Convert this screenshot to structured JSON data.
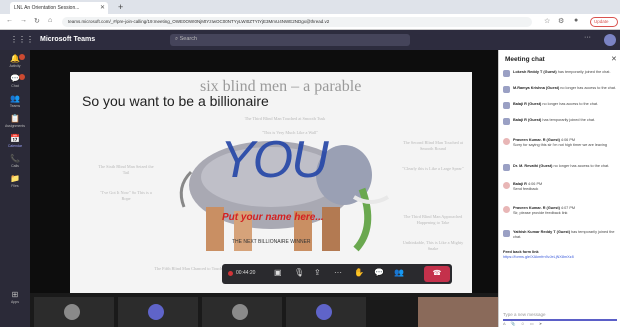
{
  "browser": {
    "tab_title": "LNL An Orientation Session...",
    "url": "teams.microsoft.com/_#/pre-join-calling/19:meeting_OWE0OWI0NjMtYzIwOC00NTYyLWI0ZTYtYjE3MmU4NWE2NDgx@thread.v2",
    "update_label": "Update"
  },
  "teams": {
    "brand": "Microsoft Teams",
    "search_placeholder": "Search"
  },
  "rail": [
    {
      "label": "Activity",
      "glyph": "🔔"
    },
    {
      "label": "Chat",
      "glyph": "💬"
    },
    {
      "label": "Teams",
      "glyph": "👥"
    },
    {
      "label": "Assignments",
      "glyph": "📋"
    },
    {
      "label": "Calendar",
      "glyph": "📅"
    },
    {
      "label": "Calls",
      "glyph": "📞"
    },
    {
      "label": "Files",
      "glyph": "📁"
    }
  ],
  "rail_bottom": {
    "label": "Apps",
    "glyph": "⊞"
  },
  "slide": {
    "title": "six blind men – a parable",
    "subtitle": "So you want to be a billionaire",
    "big_word": "YOU",
    "name_prompt": "Put your name here...",
    "caption": "THE NEXT BILLIONAIRE WINNER",
    "faint_top": "The Third Blind Man Touched at Smooth Tusk",
    "faint_top2": "\"This is Very Much Like a Wall\"",
    "faint_left1": "The Sixth Blind Man Seized the Tail",
    "faint_left2": "\"I've Got It Now\" So This is a Rope",
    "faint_right1": "The Second Blind Man Touched at Smooth Round",
    "faint_right2": "\"Clearly this is Like a Large Spear\"",
    "faint_right3": "The Third Blind Man Approached Happening to Take",
    "faint_right4": "Unthinkable, This is Like a Mighty Snake",
    "faint_bottom": "The Fifth Blind Man Chanced to Touch the Ear"
  },
  "controls": {
    "timer": "00:44:20"
  },
  "chat": {
    "title": "Meeting chat",
    "messages": [
      {
        "name": "Lokesh Reddy T (Guest)",
        "text": "has temporarily joined the chat."
      },
      {
        "name": "M.Ramya Krishna (Guest)",
        "text": "no longer has access to the chat."
      },
      {
        "name": "Balaji R (Guest)",
        "text": "no longer has access to the chat."
      },
      {
        "name": "Balaji R (Guest)",
        "text": "has temporarily joined the chat."
      },
      {
        "name": "Praveen Kumar. R (Guest)",
        "time": "4:06 PM",
        "text": "Sorry for saying this sir i'm not high timer we are leaving"
      },
      {
        "name": "Dr. M. Revathi (Guest)",
        "text": "no longer has access to the chat."
      },
      {
        "name": "Balaji R",
        "time": "4:06 PM",
        "text": "Send feedback"
      },
      {
        "name": "Praveen Kumar. R (Guest)",
        "time": "4:07 PM",
        "text": "Sir, please provide feedback link"
      },
      {
        "name": "Yathish Kumar Reddy T (Guest)",
        "text": "has temporarily joined the chat."
      },
      {
        "name": "Feed back form link",
        "text": "https://forms.gle/XAkmfrn9vJeLjNX8mXz8"
      }
    ],
    "compose_placeholder": "Type a new message"
  }
}
